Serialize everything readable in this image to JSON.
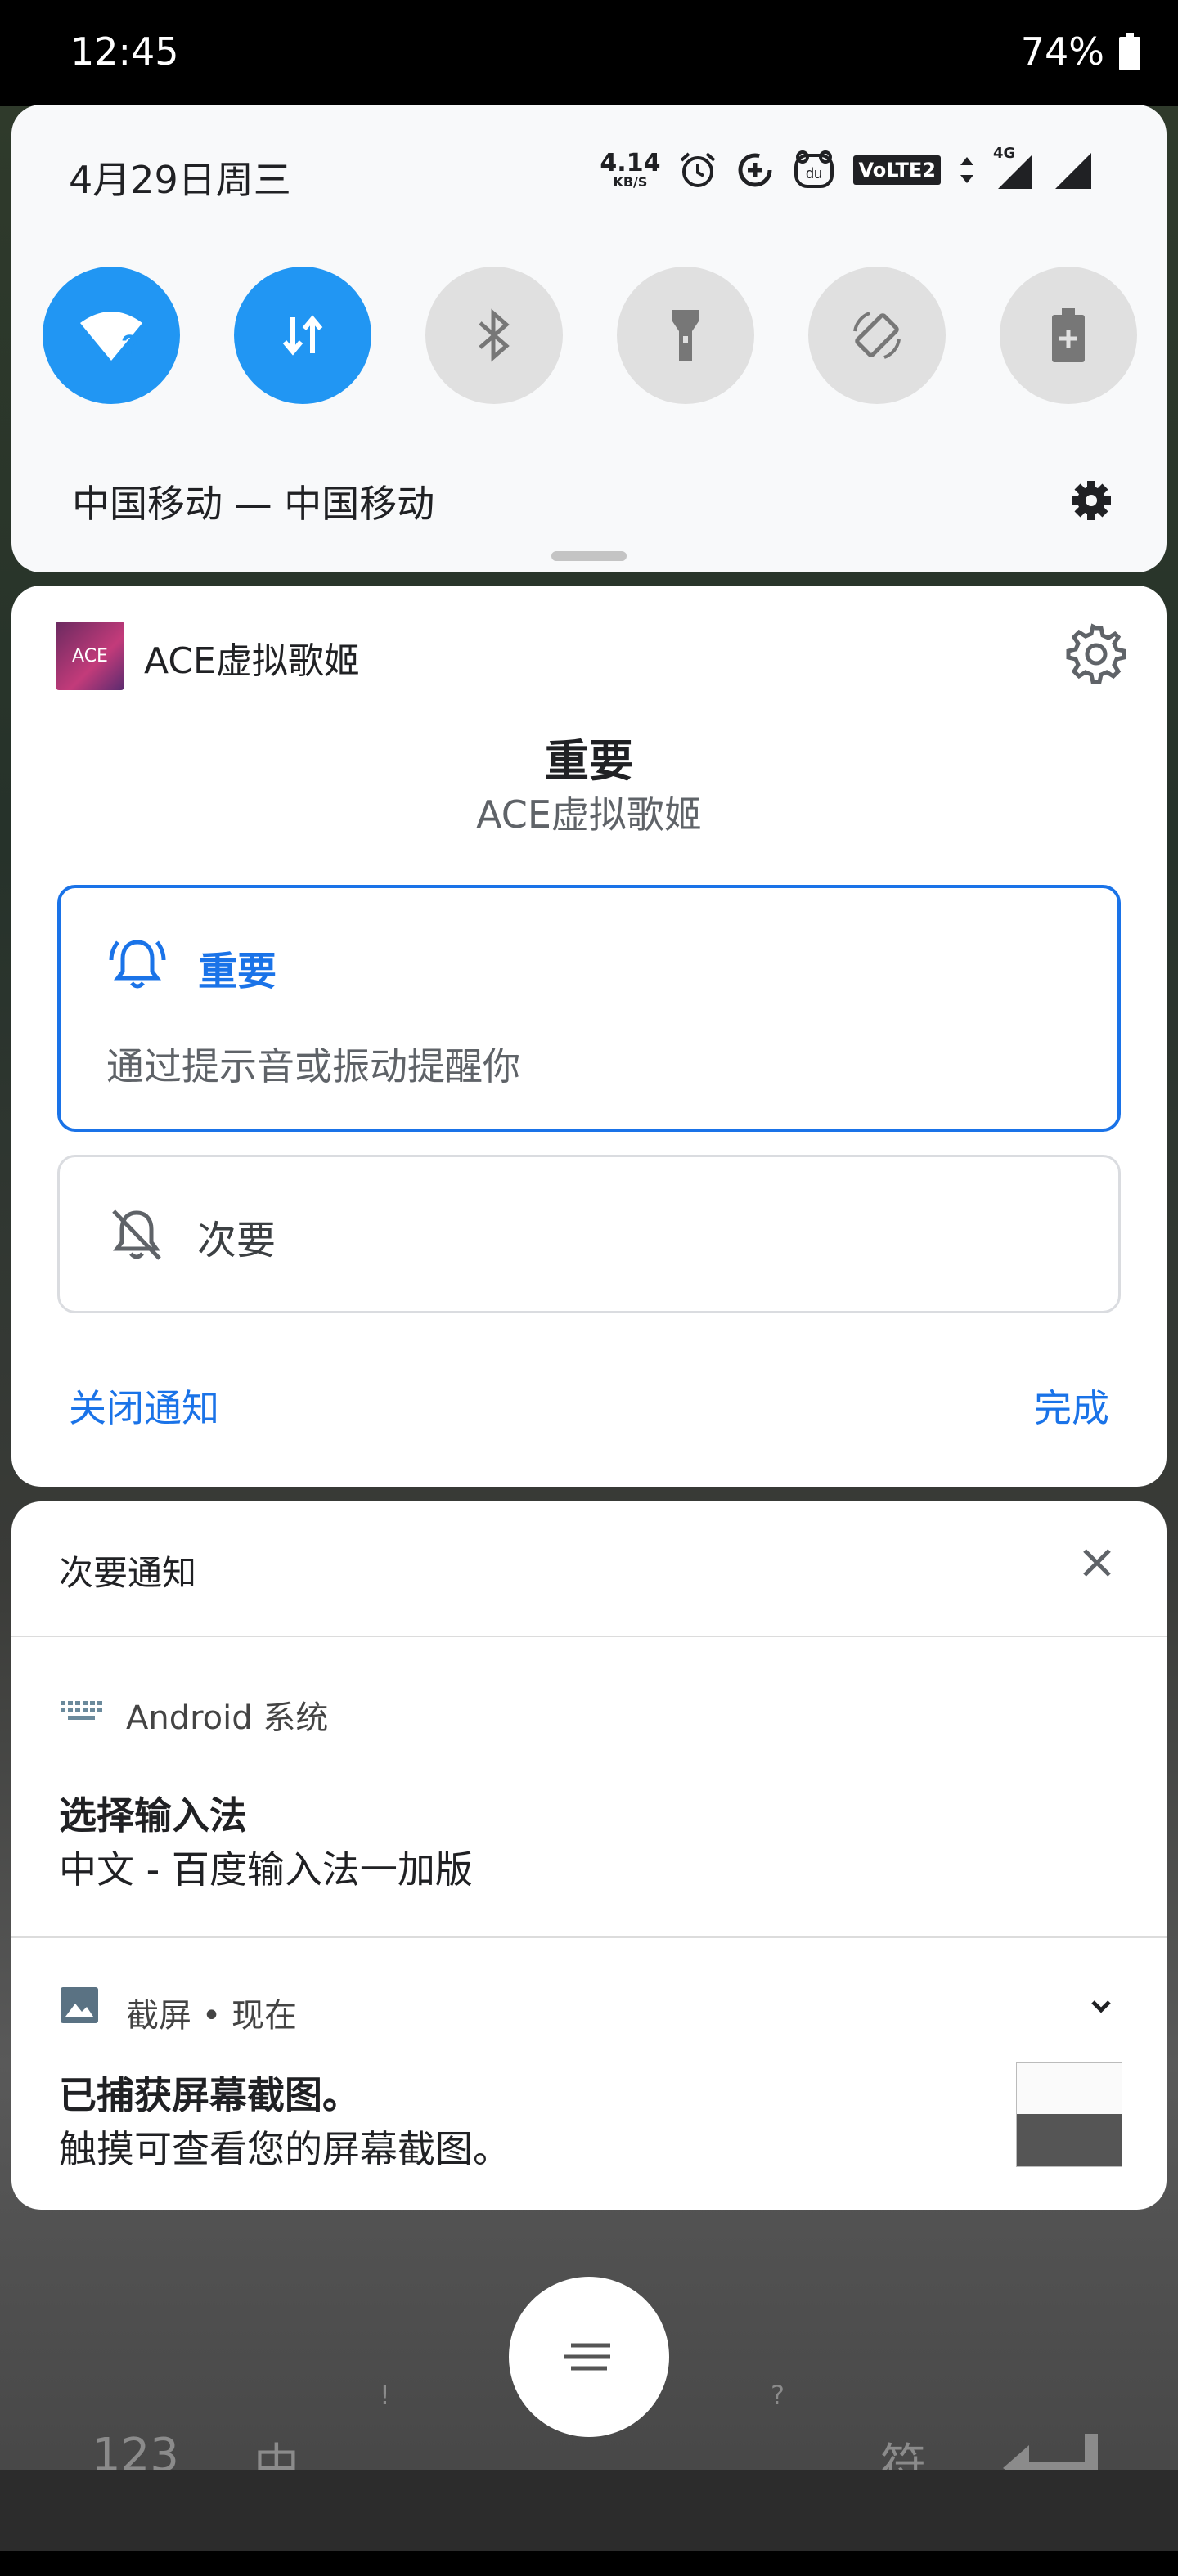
{
  "status_bar": {
    "time": "12:45",
    "battery": "74%"
  },
  "quick_settings": {
    "date": "4月29日周三",
    "net_speed_value": "4.14",
    "net_speed_unit": "KB/S",
    "volte_label": "VoLTE2",
    "network_type": "4G",
    "carrier": "中国移动 — 中国移动",
    "tiles": [
      {
        "name": "wifi",
        "state": "on"
      },
      {
        "name": "mobile-data",
        "state": "on"
      },
      {
        "name": "bluetooth",
        "state": "off"
      },
      {
        "name": "flashlight",
        "state": "off"
      },
      {
        "name": "auto-rotate",
        "state": "off"
      },
      {
        "name": "battery-saver",
        "state": "off"
      }
    ]
  },
  "importance_card": {
    "app_icon_text": "ACE",
    "app_name": "ACE虚拟歌姬",
    "title": "重要",
    "subtitle": "ACE虚拟歌姬",
    "option_important_label": "重要",
    "option_important_desc": "通过提示音或振动提醒你",
    "option_minor_label": "次要",
    "turn_off_label": "关闭通知",
    "done_label": "完成"
  },
  "minor_section": {
    "header": "次要通知",
    "notifications": [
      {
        "app": "Android 系统",
        "title": "选择输入法",
        "text": "中文 - 百度输入法一加版"
      },
      {
        "app": "截屏 • 现在",
        "title": "已捕获屏幕截图。",
        "text": "触摸可查看您的屏幕截图。"
      }
    ]
  },
  "keyboard_bg": {
    "k123": "123",
    "zh": "中",
    "comma": "，",
    "excl": "!",
    "period": "。",
    "question": "?",
    "symbols": "符"
  },
  "colors": {
    "accent": "#1a73e8",
    "tile_on": "#2196f3",
    "tile_off": "#e0e0e0"
  }
}
